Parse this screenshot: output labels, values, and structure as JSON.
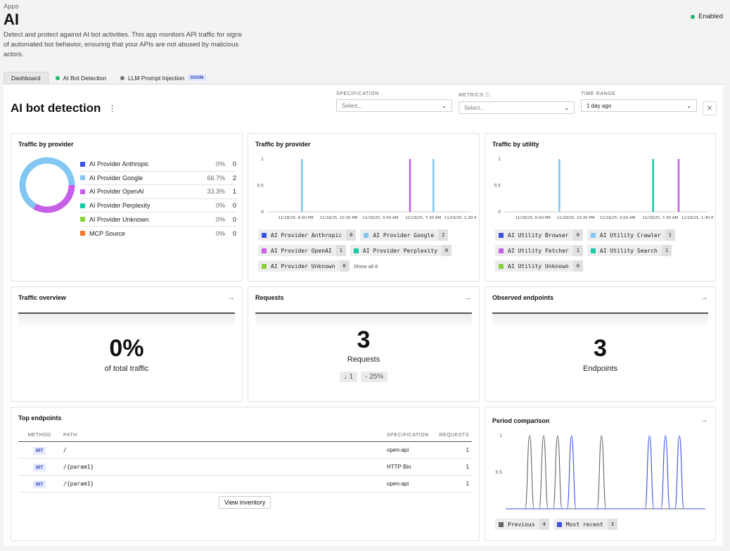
{
  "header": {
    "breadcrumb": "Apps",
    "title": "AI",
    "description": "Detect and protect against AI bot activities. This app monitors API traffic for signs of automated bot behavior, ensuring that your APIs are not abused by malicious actors.",
    "status": "Enabled",
    "status_color": "#22b573"
  },
  "tabs": [
    {
      "label": "Dashboard",
      "dot": ""
    },
    {
      "label": "AI Bot Detection",
      "dot": "#22b573"
    },
    {
      "label": "LLM Prompt Injection",
      "dot": "#777777",
      "badge": "SOON"
    }
  ],
  "dashboard": {
    "title": "AI bot detection",
    "filters": {
      "specification": {
        "label": "SPECIFICATION",
        "value": "Select..."
      },
      "metrics": {
        "label": "METRICS",
        "value": "Select..."
      },
      "time_range": {
        "label": "TIME RANGE",
        "value": "1 day ago"
      }
    }
  },
  "colors": {
    "anthropic": "#3b52e0",
    "google": "#82c7f2",
    "openai": "#c85fe8",
    "perplexity": "#17c9a6",
    "unknown": "#86d33a",
    "mcp": "#f07a2a",
    "previous": "#666666",
    "recent": "#3b52e0"
  },
  "providers_card": {
    "title": "Traffic by provider",
    "items": [
      {
        "name": "AI Provider Anthropic",
        "pct": "0%",
        "count": "0",
        "color": "#3b52e0"
      },
      {
        "name": "AI Provider Google",
        "pct": "66.7%",
        "count": "2",
        "color": "#82c7f2"
      },
      {
        "name": "AI Provider OpenAI",
        "pct": "33.3%",
        "count": "1",
        "color": "#c85fe8"
      },
      {
        "name": "AI Provider Perplexity",
        "pct": "0%",
        "count": "0",
        "color": "#17c9a6"
      },
      {
        "name": "AI Provider Unknown",
        "pct": "0%",
        "count": "0",
        "color": "#86d33a"
      },
      {
        "name": "MCP Source",
        "pct": "0%",
        "count": "0",
        "color": "#f07a2a"
      }
    ]
  },
  "provider_chart_card": {
    "title": "Traffic by provider",
    "chips": [
      {
        "name": "AI Provider Anthropic",
        "count": "0",
        "color": "#3b52e0"
      },
      {
        "name": "AI Provider Google",
        "count": "2",
        "color": "#82c7f2"
      },
      {
        "name": "AI Provider OpenAI",
        "count": "1",
        "color": "#c85fe8"
      },
      {
        "name": "AI Provider Perplexity",
        "count": "0",
        "color": "#17c9a6"
      },
      {
        "name": "AI Provider Unknown",
        "count": "0",
        "color": "#86d33a"
      }
    ],
    "show_all": "Show all 6"
  },
  "utility_chart_card": {
    "title": "Traffic by utility",
    "chips": [
      {
        "name": "AI Utility Browser",
        "count": "0",
        "color": "#3b52e0"
      },
      {
        "name": "AI Utility Crawler",
        "count": "1",
        "color": "#82c7f2"
      },
      {
        "name": "AI Utility Fetcher",
        "count": "1",
        "color": "#c85fe8"
      },
      {
        "name": "AI Utility Search",
        "count": "1",
        "color": "#17c9a6"
      },
      {
        "name": "AI Utility Unknown",
        "count": "0",
        "color": "#86d33a"
      }
    ]
  },
  "traffic_overview": {
    "title": "Traffic overview",
    "value": "0%",
    "label": "of total traffic"
  },
  "requests": {
    "title": "Requests",
    "value": "3",
    "label": "Requests",
    "delta": "↓ 1",
    "delta_pct": "- 25%"
  },
  "observed": {
    "title": "Observed endpoints",
    "value": "3",
    "label": "Endpoints"
  },
  "top_endpoints": {
    "title": "Top endpoints",
    "columns": [
      "METHOD",
      "PATH",
      "SPECIFICATION",
      "REQUESTS"
    ],
    "rows": [
      {
        "method": "GET",
        "path": "/",
        "spec": "open-api",
        "requests": "1"
      },
      {
        "method": "GET",
        "path": "/{param1}",
        "spec": "HTTP Bin",
        "requests": "1"
      },
      {
        "method": "GET",
        "path": "/{param1}",
        "spec": "open-api",
        "requests": "1"
      }
    ],
    "button": "View inventory"
  },
  "period_card": {
    "title": "Period comparison",
    "chips": [
      {
        "name": "Previous",
        "count": "4",
        "color": "#666666"
      },
      {
        "name": "Most recent",
        "count": "3",
        "color": "#3b52e0"
      }
    ]
  },
  "chart_data": [
    {
      "type": "pie",
      "title": "Traffic by provider",
      "categories": [
        "AI Provider Anthropic",
        "AI Provider Google",
        "AI Provider OpenAI",
        "AI Provider Perplexity",
        "AI Provider Unknown",
        "MCP Source"
      ],
      "values": [
        0,
        2,
        1,
        0,
        0,
        0
      ],
      "colors": [
        "#3b52e0",
        "#82c7f2",
        "#c85fe8",
        "#17c9a6",
        "#86d33a",
        "#f07a2a"
      ]
    },
    {
      "type": "bar",
      "title": "Traffic by provider",
      "x_ticks": [
        "11/18/25, 6:00 PM",
        "11/18/25, 10:30 PM",
        "11/19/25, 3:00 AM",
        "11/19/25, 7:30 AM",
        "11/19/25, 1:30 PM"
      ],
      "y_ticks": [
        "0",
        "0.5",
        "1"
      ],
      "ylim": [
        0,
        1
      ],
      "bars": [
        {
          "x": 0.17,
          "value": 1,
          "color": "#82c7f2"
        },
        {
          "x": 0.7,
          "value": 1,
          "color": "#c85fe8"
        },
        {
          "x": 0.815,
          "value": 1,
          "color": "#82c7f2"
        }
      ]
    },
    {
      "type": "bar",
      "title": "Traffic by utility",
      "x_ticks": [
        "11/18/25, 6:00 PM",
        "11/18/25, 10:30 PM",
        "11/19/25, 3:00 AM",
        "11/19/25, 7:30 AM",
        "11/19/25, 1:30 PM"
      ],
      "y_ticks": [
        "0",
        "0.5",
        "1"
      ],
      "ylim": [
        0,
        1
      ],
      "bars": [
        {
          "x": 0.27,
          "value": 1,
          "color": "#82c7f2"
        },
        {
          "x": 0.73,
          "value": 1,
          "color": "#17c9a6"
        },
        {
          "x": 0.855,
          "value": 1,
          "color": "#c85fe8"
        }
      ]
    },
    {
      "type": "line",
      "title": "Period comparison",
      "y_ticks": [
        "0.5",
        "1"
      ],
      "ylim": [
        0,
        1
      ],
      "series": [
        {
          "name": "Previous",
          "color": "#666666",
          "peaks": [
            0.12,
            0.19,
            0.26,
            0.48
          ]
        },
        {
          "name": "Most recent",
          "color": "#3b52e0",
          "peaks": [
            0.33,
            0.72,
            0.8,
            0.87
          ]
        }
      ]
    }
  ]
}
